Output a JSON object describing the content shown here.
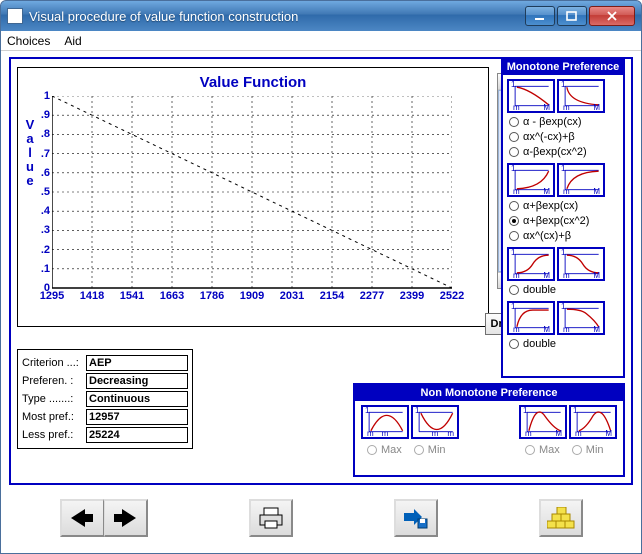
{
  "window": {
    "title": "Visual procedure of value function construction"
  },
  "menu": {
    "choices": "Choices",
    "aid": "Aid"
  },
  "chart_data": {
    "type": "line",
    "title": "Value Function",
    "ylabel": "Value",
    "xlabel": "",
    "ylim": [
      0,
      1
    ],
    "yticks": [
      "1",
      ".9",
      ".8",
      ".7",
      ".6",
      ".5",
      ".4",
      ".3",
      ".2",
      ".1",
      "0"
    ],
    "categories": [
      "1295",
      "1418",
      "1541",
      "1663",
      "1786",
      "1909",
      "2031",
      "2154",
      "2277",
      "2399",
      "2522"
    ],
    "series": [
      {
        "name": "value",
        "values": [
          1.0,
          0.9,
          0.8,
          0.7,
          0.6,
          0.5,
          0.4,
          0.3,
          0.2,
          0.1,
          0.0
        ]
      }
    ]
  },
  "draw_btn": "Draw",
  "info": {
    "criterion_label": "Criterion ...:",
    "criterion": "AEP",
    "preferen_label": "Preferen. :",
    "preferen": "Decreasing",
    "type_label": "Type .......:",
    "type": "Continuous",
    "most_label": "Most pref.:",
    "most": "12957",
    "less_label": "Less pref.:",
    "less": "25224"
  },
  "mono": {
    "title": "Monotone Preference",
    "group1": {
      "r1": "α - βexp(cx)",
      "r2": "αx^(-cx)+β",
      "r3": "α-βexp(cx^2)"
    },
    "group2": {
      "r1": "α+βexp(cx)",
      "r2": "α+βexp(cx^2)",
      "r3": "αx^(cx)+β"
    },
    "double1": "double",
    "double2": "double"
  },
  "nonmono": {
    "title": "Non Monotone Preference",
    "max": "Max",
    "min": "Min"
  }
}
